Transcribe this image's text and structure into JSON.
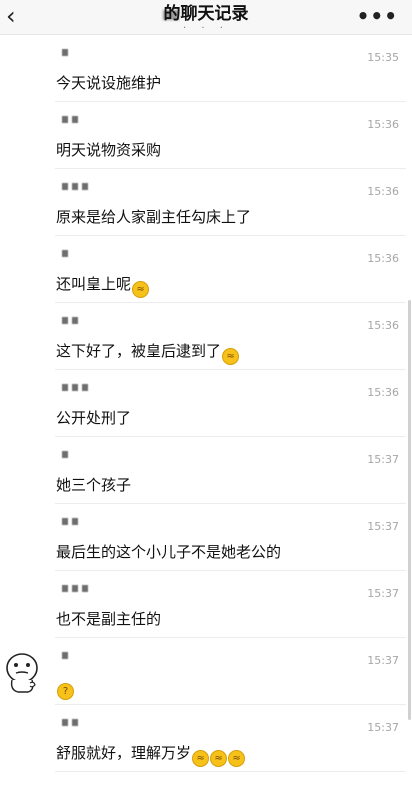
{
  "header": {
    "back_icon": "‹",
    "title": "的聊天记录",
    "subtitle": "· · ·",
    "more_icon": "•••"
  },
  "messages": [
    {
      "time": "15:35",
      "text": "今天说设施维护",
      "emoji": []
    },
    {
      "time": "15:36",
      "text": "明天说物资采购",
      "emoji": []
    },
    {
      "time": "15:36",
      "text": "原来是给人家副主任勾床上了",
      "emoji": []
    },
    {
      "time": "15:36",
      "text": "还叫皇上呢",
      "emoji": [
        "laugh-cry"
      ]
    },
    {
      "time": "15:36",
      "text": "这下好了，被皇后逮到了",
      "emoji": [
        "laugh-cry"
      ]
    },
    {
      "time": "15:36",
      "text": "公开处刑了",
      "emoji": []
    },
    {
      "time": "15:37",
      "text": "她三个孩子",
      "emoji": []
    },
    {
      "time": "15:37",
      "text": "最后生的这个小儿子不是她老公的",
      "emoji": []
    },
    {
      "time": "15:37",
      "text": "也不是副主任的",
      "emoji": []
    },
    {
      "time": "15:37",
      "text": "",
      "emoji": [
        "thinking"
      ]
    },
    {
      "time": "15:37",
      "text": "舒服就好，理解万岁",
      "emoji": [
        "laugh-cry",
        "laugh-cry",
        "laugh-cry"
      ]
    }
  ],
  "emoji_glyphs": {
    "laugh-cry": "😂",
    "thinking": "🤔"
  }
}
